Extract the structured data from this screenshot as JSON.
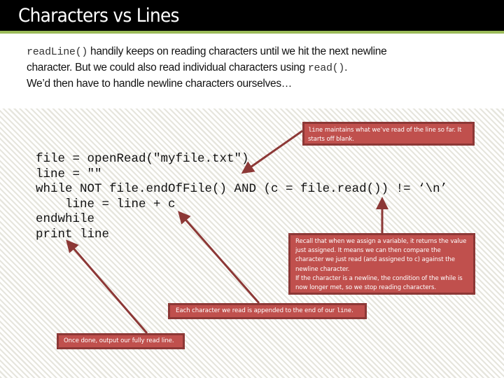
{
  "slide": {
    "title": "Characters vs Lines",
    "accent_color": "#9bbb59",
    "callout_color": "#c0504d",
    "arrow_color": "#8c3836"
  },
  "intro": {
    "line1_code": "readLine()",
    "line1_text": " handily keeps on reading characters until we hit the next newline",
    "line2_text": "character. But we could also read individual characters using ",
    "line2_code": "read()",
    "line2_end": ".",
    "line3_text": "We’d then have to handle newline characters ourselves…"
  },
  "code": {
    "lines": [
      "file = openRead(\"myfile.txt\")",
      "line = \"\"",
      "while NOT file.endOfFile() AND (c = file.read()) != ‘\\n’",
      "    line = line + c",
      "endwhile",
      "print line"
    ]
  },
  "callouts": {
    "line_var": {
      "code": "line",
      "text": " maintains what we’ve read of the line so far. It starts off blank."
    },
    "assign": {
      "para1": "Recall that when we assign a variable, it returns the value just assigned. It means we can then compare the character we just read (and assigned to c) against the newline character.",
      "para2": "If the character is a newline, the condition of the while is now longer met, so we stop reading characters."
    },
    "append": {
      "text": "Each character we read is appended to the end of our ",
      "code": "line",
      "end": "."
    },
    "output": {
      "text": "Once done, output our fully read line."
    }
  }
}
